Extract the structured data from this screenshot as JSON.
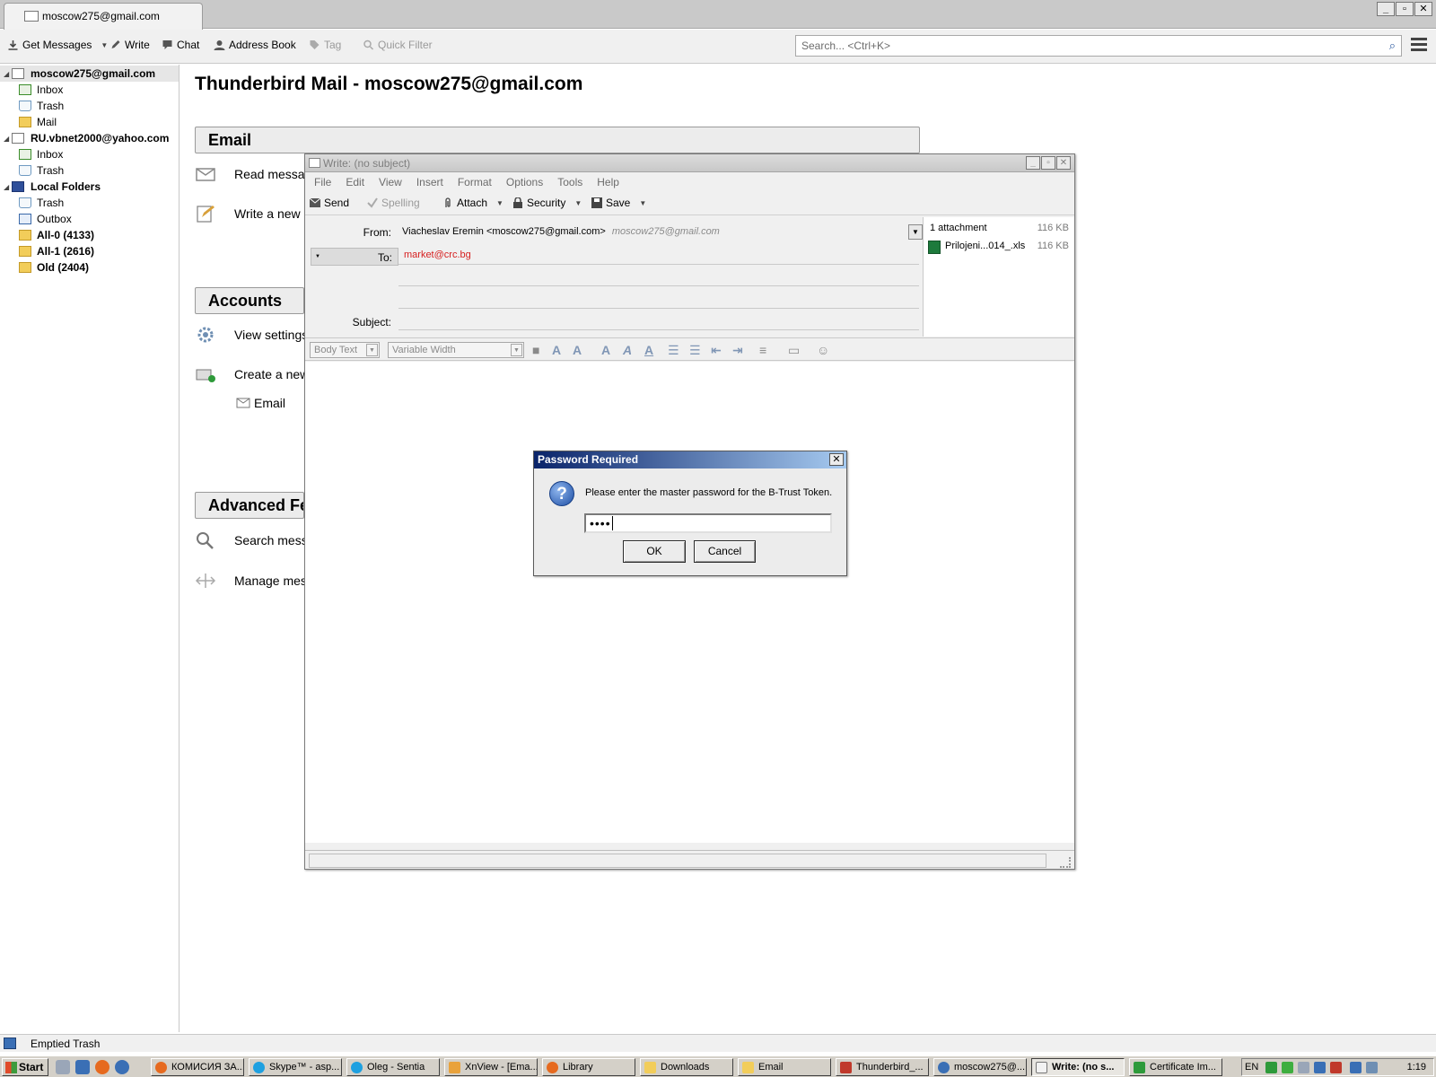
{
  "window": {
    "tab_label": "moscow275@gmail.com",
    "minimize": "_",
    "restore": "▫",
    "close": "✕"
  },
  "toolbar": {
    "get_messages": "Get Messages",
    "write": "Write",
    "chat": "Chat",
    "address_book": "Address Book",
    "tag": "Tag",
    "quick_filter": "Quick Filter",
    "search_placeholder": "Search... <Ctrl+K>"
  },
  "folders": {
    "account1": "moscow275@gmail.com",
    "account1_inbox": "Inbox",
    "account1_trash": "Trash",
    "account1_mail": "Mail",
    "account2": "RU.vbnet2000@yahoo.com",
    "account2_inbox": "Inbox",
    "account2_trash": "Trash",
    "local": "Local Folders",
    "local_trash": "Trash",
    "local_outbox": "Outbox",
    "all0": "All-0 (4133)",
    "all1": "All-1 (2616)",
    "old": "Old (2404)"
  },
  "central": {
    "title": "Thunderbird Mail - moscow275@gmail.com",
    "email_section": "Email",
    "read_messages": "Read messag",
    "write_message": "Write a new",
    "accounts_section": "Accounts",
    "view_settings": "View settings",
    "create_new": "Create a new",
    "email_link": "Email",
    "advanced_section": "Advanced Fe",
    "search_messages": "Search mess",
    "manage_messages": "Manage mes"
  },
  "compose": {
    "title": "Write: (no subject)",
    "menu": [
      "File",
      "Edit",
      "View",
      "Insert",
      "Format",
      "Options",
      "Tools",
      "Help"
    ],
    "send": "Send",
    "spelling": "Spelling",
    "attach": "Attach",
    "security": "Security",
    "save": "Save",
    "from_label": "From:",
    "from_value": "Viacheslav Eremin <moscow275@gmail.com>",
    "from_hint": "moscow275@gmail.com",
    "to_label": "To:",
    "to_value": "market@crc.bg",
    "subject_label": "Subject:",
    "attachments_header": "1 attachment",
    "attachments_total": "116 KB",
    "attachment_name": "Prilojeni...014_.xls",
    "attachment_size": "116 KB",
    "paragraph_format": "Body Text",
    "font": "Variable Width"
  },
  "dialog": {
    "title": "Password Required",
    "message": "Please enter the master password for the B-Trust Token.",
    "password_mask": "••••",
    "ok": "OK",
    "cancel": "Cancel"
  },
  "status": {
    "text": "Emptied Trash"
  },
  "taskbar": {
    "start": "Start",
    "items": [
      "КОМИСИЯ ЗА...",
      "Skype™ - asp...",
      "Oleg - Sentia",
      "XnView - [Ema...",
      "Library",
      "Downloads",
      "Email",
      "Thunderbird_...",
      "moscow275@...",
      "Write: (no s...",
      "Certificate Im..."
    ],
    "language": "EN",
    "clock": "1:19"
  }
}
